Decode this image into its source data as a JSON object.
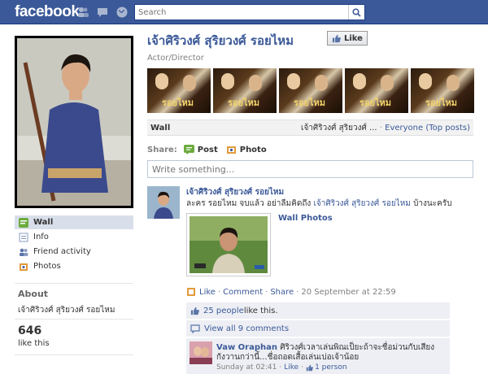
{
  "topbar": {
    "logo": "facebook",
    "search_placeholder": "Search"
  },
  "page": {
    "name": "เจ้าศิริวงศ์ สุริยวงศ์ รอยไหม",
    "like_label": "Like",
    "category": "Actor/Director"
  },
  "left_nav": [
    {
      "label": "Wall"
    },
    {
      "label": "Info"
    },
    {
      "label": "Friend activity"
    },
    {
      "label": "Photos"
    }
  ],
  "about": {
    "heading": "About",
    "text": "เจ้าศิริวงศ์ สุริยวงศ์ รอยไหม"
  },
  "likes": {
    "count": "646",
    "label": "like this"
  },
  "photo_strip": {
    "caption": "รอยไหม"
  },
  "wall_bar": {
    "title": "Wall",
    "owner": "เจ้าศิริวงศ์ สุริยวงศ์ ...",
    "separator": "·",
    "filter": "Everyone (Top posts)"
  },
  "share": {
    "label": "Share:",
    "post": "Post",
    "photo": "Photo"
  },
  "composer": {
    "placeholder": "Write something..."
  },
  "story": {
    "author": "เจ้าศิริวงศ์ สุริยวงศ์ รอยไหม",
    "message_prefix": "ละคร รอยไหม จบแล้ว อย่าลืมคิดถึง ",
    "message_link": "เจ้าศิริวงศ์ สุริยวงศ์ รอยไหม",
    "message_suffix": " บ้างนะครับ",
    "attachment_title": "Wall Photos",
    "actions": {
      "like": "Like",
      "comment": "Comment",
      "share": "Share",
      "time": "20 September at 22:59"
    },
    "likes_link": "25 people",
    "likes_suffix": " like this.",
    "view_comments": "View all 9 comments"
  },
  "comment": {
    "author": "Vaw Oraphan",
    "text": "ศิริวงศ์เวลาเล่นพิณเป็ยะถ้าจะชื่อม่วนกับเสียงกังวานกว่านี้...ชื่อถอดเสื้อเล่นเบ่อเจ้าน้อย",
    "time": "Sunday at 02:41",
    "like": "Like",
    "like_count": "1 person"
  },
  "colors": {
    "brand": "#3b5998",
    "ufi_bg": "#edeff4",
    "nav_active_bg": "#d8dfea"
  }
}
